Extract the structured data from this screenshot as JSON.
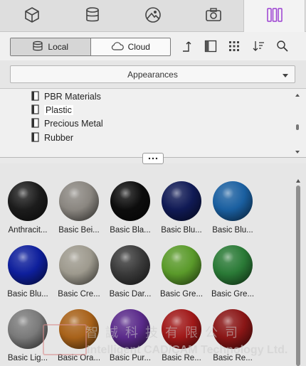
{
  "tabs": [
    {
      "icon": "cube-icon"
    },
    {
      "icon": "database-icon"
    },
    {
      "icon": "image-icon"
    },
    {
      "icon": "camera-icon"
    },
    {
      "icon": "material-library-icon",
      "active": true
    }
  ],
  "toolbar": {
    "local_label": "Local",
    "cloud_label": "Cloud",
    "tools": [
      "upload-icon",
      "layout-icon",
      "grid-view-icon",
      "sort-icon",
      "search-icon"
    ]
  },
  "appearances_dropdown": {
    "selected": "Appearances"
  },
  "tree": {
    "items": [
      {
        "label": "PBR Materials"
      },
      {
        "label": "Plastic",
        "selected": true
      },
      {
        "label": "Precious Metal"
      },
      {
        "label": "Rubber"
      }
    ]
  },
  "materials": [
    {
      "label": "Anthracit...",
      "color": "#1c1c1c"
    },
    {
      "label": "Basic Bei...",
      "color": "#8a8680"
    },
    {
      "label": "Basic Bla...",
      "color": "#0d0d0d"
    },
    {
      "label": "Basic Blu...",
      "color": "#101a55"
    },
    {
      "label": "Basic Blu...",
      "color": "#1a5fa0"
    },
    {
      "label": "Basic Blu...",
      "color": "#0e1f9c"
    },
    {
      "label": "Basic Cre...",
      "color": "#9e9a8e"
    },
    {
      "label": "Basic Dar...",
      "color": "#3a3a3a"
    },
    {
      "label": "Basic Gre...",
      "color": "#5a9a2a"
    },
    {
      "label": "Basic Gre...",
      "color": "#2a7a36"
    },
    {
      "label": "Basic Lig...",
      "color": "#7a7a7a"
    },
    {
      "label": "Basic Ora...",
      "color": "#a8621a"
    },
    {
      "label": "Basic Pur...",
      "color": "#5a2a8a"
    },
    {
      "label": "Basic Re...",
      "color": "#a01818"
    },
    {
      "label": "Basic Re...",
      "color": "#8a1616"
    }
  ],
  "watermark": {
    "chinese": "智誠科技有限公司",
    "english": "Intelligent CAD/CAM Technology Ltd."
  },
  "colors": {
    "accent": "#9b3fd1"
  }
}
